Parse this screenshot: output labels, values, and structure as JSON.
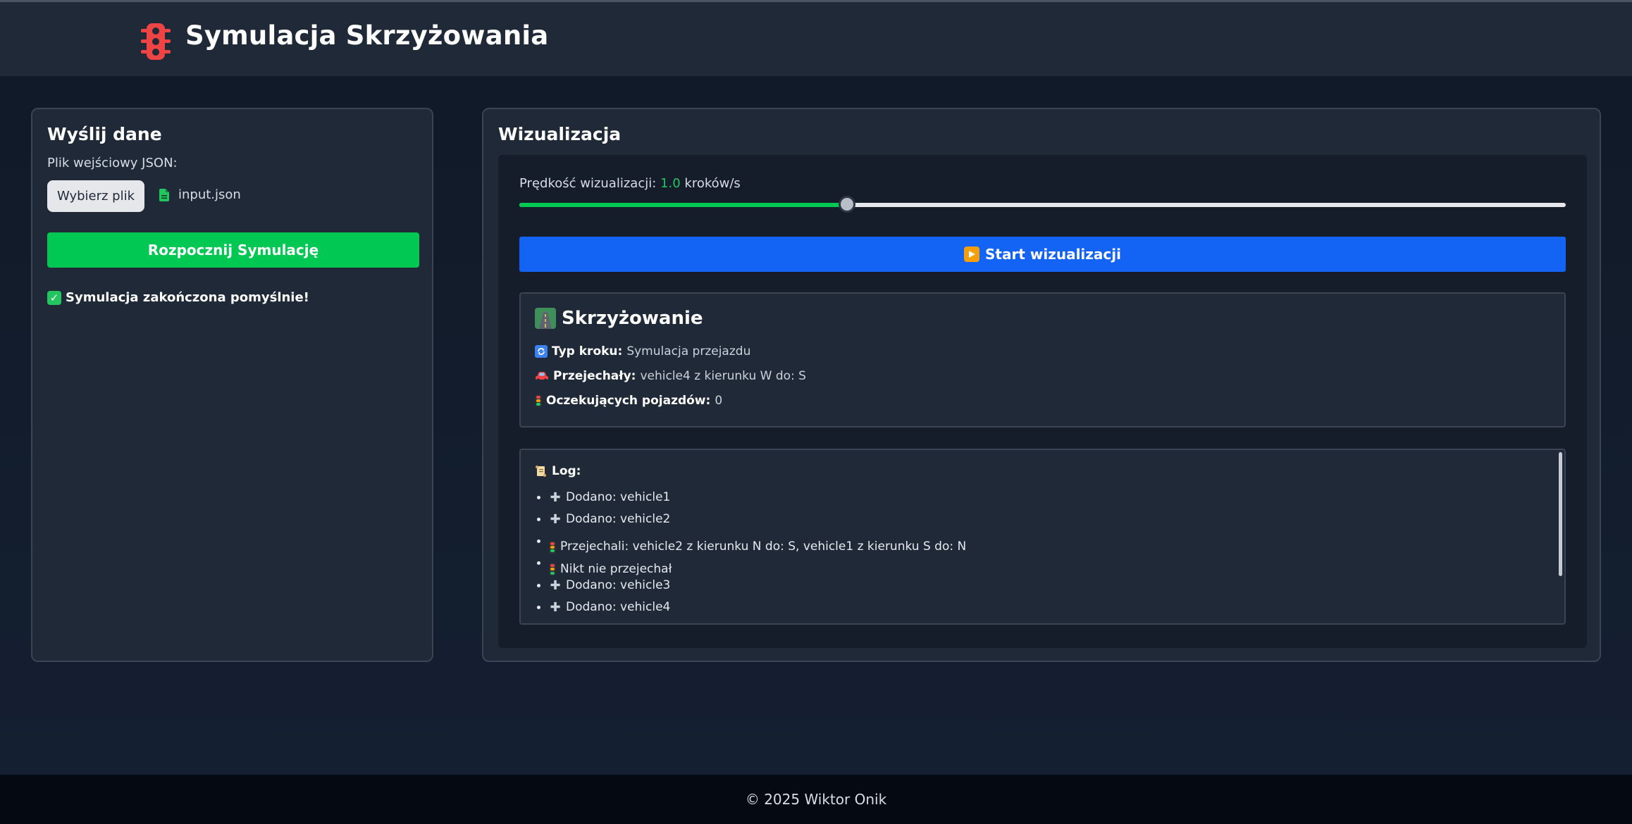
{
  "header": {
    "title": "Symulacja Skrzyżowania",
    "logo_icon": "traffic-light-icon",
    "logo_color": "#ef4444"
  },
  "upload_panel": {
    "heading": "Wyślij dane",
    "file_label": "Plik wejściowy JSON:",
    "choose_button": "Wybierz plik",
    "file_name": "input.json",
    "start_button": "Rozpocznij Symulację",
    "status": "Symulacja zakończona pomyślnie!"
  },
  "visualization": {
    "heading": "Wizualizacja",
    "speed_label": "Prędkość wizualizacji:",
    "speed_value": "1.0",
    "speed_unit": "kroków/s",
    "slider_fraction": 0.313,
    "start_button": "Start wizualizacji",
    "intersection": {
      "title": "Skrzyżowanie",
      "step_type_label": "Typ kroku:",
      "step_type_value": "Symulacja przejazdu",
      "passed_label": "Przejechały:",
      "passed_value": "vehicle4 z kierunku W do: S",
      "waiting_label": "Oczekujących pojazdów:",
      "waiting_value": "0"
    },
    "log": {
      "title": "Log:",
      "entries": [
        {
          "icon": "plus-icon",
          "text": "Dodano: vehicle1"
        },
        {
          "icon": "plus-icon",
          "text": "Dodano: vehicle2"
        },
        {
          "icon": "traffic-light-icon",
          "text": "Przejechali: vehicle2 z kierunku N do: S, vehicle1 z kierunku S do: N"
        },
        {
          "icon": "traffic-light-icon",
          "text": "Nikt nie przejechał"
        },
        {
          "icon": "plus-icon",
          "text": "Dodano: vehicle3"
        },
        {
          "icon": "plus-icon",
          "text": "Dodano: vehicle4"
        }
      ]
    }
  },
  "colors": {
    "accent_green": "#00c853",
    "accent_blue": "#1363f5",
    "panel": "#1f2937"
  },
  "footer": {
    "text": "© 2025 Wiktor Onik"
  }
}
